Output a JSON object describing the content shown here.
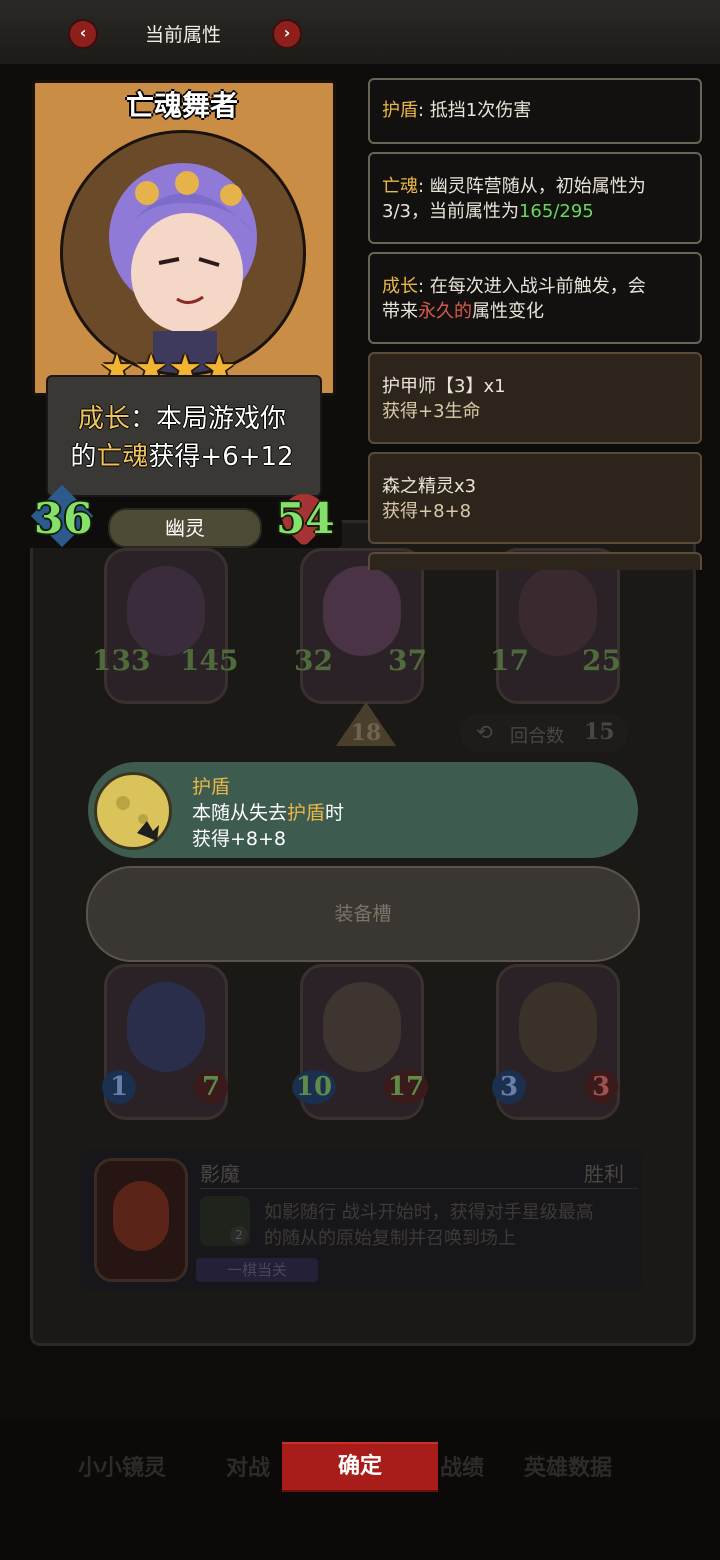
{
  "header": {
    "title": "当前属性",
    "prev_icon": "‹",
    "next_icon": "›"
  },
  "hero": {
    "name": "亡魂舞者",
    "stars": 4,
    "desc_line1_a": "成长",
    "desc_line1_b": "：本局游戏你",
    "desc_line2_a": "的",
    "desc_line2_b": "亡魂",
    "desc_line2_c": "获得+6+12",
    "tribe": "幽灵",
    "attack": "36",
    "health": "54"
  },
  "keywords": {
    "shield": {
      "name": "护盾",
      "text": ": 抵挡1次伤害"
    },
    "soul": {
      "name": "亡魂",
      "line1": ": 幽灵阵营随从，初始属性为",
      "line2_a": "3/3，当前属性为",
      "line2_b": "165/295"
    },
    "growth": {
      "name": "成长",
      "line1": ": 在每次进入战斗前触发，会",
      "line2_a": "带来",
      "line2_b": "永久的",
      "line2_c": "属性变化"
    }
  },
  "sources": [
    {
      "title": "护甲师【3】x1",
      "gain": "获得+3生命"
    },
    {
      "title": "森之精灵x3",
      "gain": "获得+8+8"
    }
  ],
  "board_top": [
    {
      "attack": "133",
      "health": "145"
    },
    {
      "attack": "32",
      "health": "37"
    },
    {
      "attack": "17",
      "health": "25"
    }
  ],
  "tier_badge": "18",
  "round": {
    "label": "回合数",
    "value": "15"
  },
  "shield_popup": {
    "title": "护盾",
    "line1_a": "本随从失去",
    "line1_b": "护盾",
    "line1_c": "时",
    "line2": "获得+8+8"
  },
  "equip_slot": {
    "label": "装备槽"
  },
  "hand": [
    {
      "attack": "1",
      "health": "7"
    },
    {
      "attack": "10",
      "health": "17"
    },
    {
      "attack": "3",
      "health": "3"
    }
  ],
  "opponent": {
    "name": "影魔",
    "result": "胜利",
    "skill_name": "如影随行",
    "skill_line1": "战斗开始时，获得对手星级最高",
    "skill_line2": "的随从的原始复制并召唤到场上",
    "badge": "一棋当关",
    "level": "2"
  },
  "bottom_nav": {
    "tab1": "小小镜灵",
    "tab2": "对战",
    "tab3": "战绩",
    "tab4": "英雄数据",
    "confirm": "确定"
  },
  "colors": {
    "accent_gold": "#e8b748",
    "value_green": "#68d85c",
    "confirm_red": "#a81d1a",
    "popup_teal": "#3e5b50"
  }
}
